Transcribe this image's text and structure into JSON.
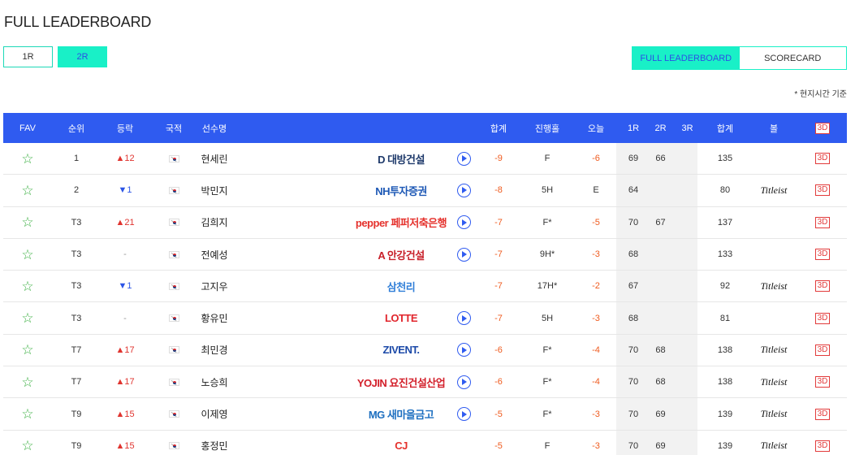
{
  "page": {
    "title": "FULL LEADERBOARD",
    "time_note": "* 현지시간 기준"
  },
  "round_tabs": [
    {
      "label": "1R",
      "active": false
    },
    {
      "label": "2R",
      "active": true
    }
  ],
  "view_tabs": [
    {
      "label": "FULL LEADERBOARD",
      "active": true
    },
    {
      "label": "SCORECARD",
      "active": false
    }
  ],
  "colors": {
    "header_bg": "#2f5bf0",
    "accent": "#19f0c7",
    "up": "#e0342f",
    "down": "#2c55e6",
    "score_red": "#ef5b1f",
    "star": "#3cb043"
  },
  "header": {
    "fav": "FAV",
    "rank": "순위",
    "move": "등락",
    "nation": "국적",
    "player": "선수명",
    "total": "합계",
    "progress": "진행홀",
    "today": "오늘",
    "r1": "1R",
    "r2": "2R",
    "r3": "3R",
    "sum": "합계",
    "ball": "볼",
    "threed": "3D"
  },
  "rows": [
    {
      "rank": "1",
      "move": "▲12",
      "dir": "up",
      "name": "현세린",
      "sponsor": "D 대방건설",
      "sponsor_color": "#1f3a6b",
      "play": true,
      "total": "-9",
      "progress": "F",
      "today": "-6",
      "r1": "69",
      "r2": "66",
      "sum": "135",
      "ball": "",
      "threed": "3D"
    },
    {
      "rank": "2",
      "move": "▼1",
      "dir": "down",
      "name": "박민지",
      "sponsor": "NH투자증권",
      "sponsor_color": "#1d58b5",
      "play": true,
      "total": "-8",
      "progress": "5H",
      "today": "E",
      "r1": "64",
      "r2": "",
      "sum": "80",
      "ball": "Titleist",
      "threed": "3D"
    },
    {
      "rank": "T3",
      "move": "▲21",
      "dir": "up",
      "name": "김희지",
      "sponsor": "pepper 페퍼저축은행",
      "sponsor_color": "#e5322d",
      "play": true,
      "total": "-7",
      "progress": "F*",
      "today": "-5",
      "r1": "70",
      "r2": "67",
      "sum": "137",
      "ball": "",
      "threed": "3D"
    },
    {
      "rank": "T3",
      "move": "-",
      "dir": "neutral",
      "name": "전예성",
      "sponsor": "A 안강건설",
      "sponsor_color": "#c8202a",
      "play": true,
      "total": "-7",
      "progress": "9H*",
      "today": "-3",
      "r1": "68",
      "r2": "",
      "sum": "133",
      "ball": "",
      "threed": "3D"
    },
    {
      "rank": "T3",
      "move": "▼1",
      "dir": "down",
      "name": "고지우",
      "sponsor": "삼천리",
      "sponsor_color": "#2f7ed8",
      "play": false,
      "total": "-7",
      "progress": "17H*",
      "today": "-2",
      "r1": "67",
      "r2": "",
      "sum": "92",
      "ball": "Titleist",
      "threed": "3D"
    },
    {
      "rank": "T3",
      "move": "-",
      "dir": "neutral",
      "name": "황유민",
      "sponsor": "LOTTE",
      "sponsor_color": "#e1262d",
      "play": true,
      "total": "-7",
      "progress": "5H",
      "today": "-3",
      "r1": "68",
      "r2": "",
      "sum": "81",
      "ball": "",
      "threed": "3D"
    },
    {
      "rank": "T7",
      "move": "▲17",
      "dir": "up",
      "name": "최민경",
      "sponsor": "ZIVENT.",
      "sponsor_color": "#1c4aa8",
      "play": true,
      "total": "-6",
      "progress": "F*",
      "today": "-4",
      "r1": "70",
      "r2": "68",
      "sum": "138",
      "ball": "Titleist",
      "threed": "3D"
    },
    {
      "rank": "T7",
      "move": "▲17",
      "dir": "up",
      "name": "노승희",
      "sponsor": "YOJIN 요진건설산업",
      "sponsor_color": "#d3202b",
      "play": true,
      "total": "-6",
      "progress": "F*",
      "today": "-4",
      "r1": "70",
      "r2": "68",
      "sum": "138",
      "ball": "Titleist",
      "threed": "3D"
    },
    {
      "rank": "T9",
      "move": "▲15",
      "dir": "up",
      "name": "이제영",
      "sponsor": "MG 새마을금고",
      "sponsor_color": "#1d6fc0",
      "play": true,
      "total": "-5",
      "progress": "F*",
      "today": "-3",
      "r1": "70",
      "r2": "69",
      "sum": "139",
      "ball": "Titleist",
      "threed": "3D"
    },
    {
      "rank": "T9",
      "move": "▲15",
      "dir": "up",
      "name": "홍정민",
      "sponsor": "CJ",
      "sponsor_color": "#e5322d",
      "play": false,
      "total": "-5",
      "progress": "F",
      "today": "-3",
      "r1": "70",
      "r2": "69",
      "sum": "139",
      "ball": "Titleist",
      "threed": "3D"
    }
  ]
}
